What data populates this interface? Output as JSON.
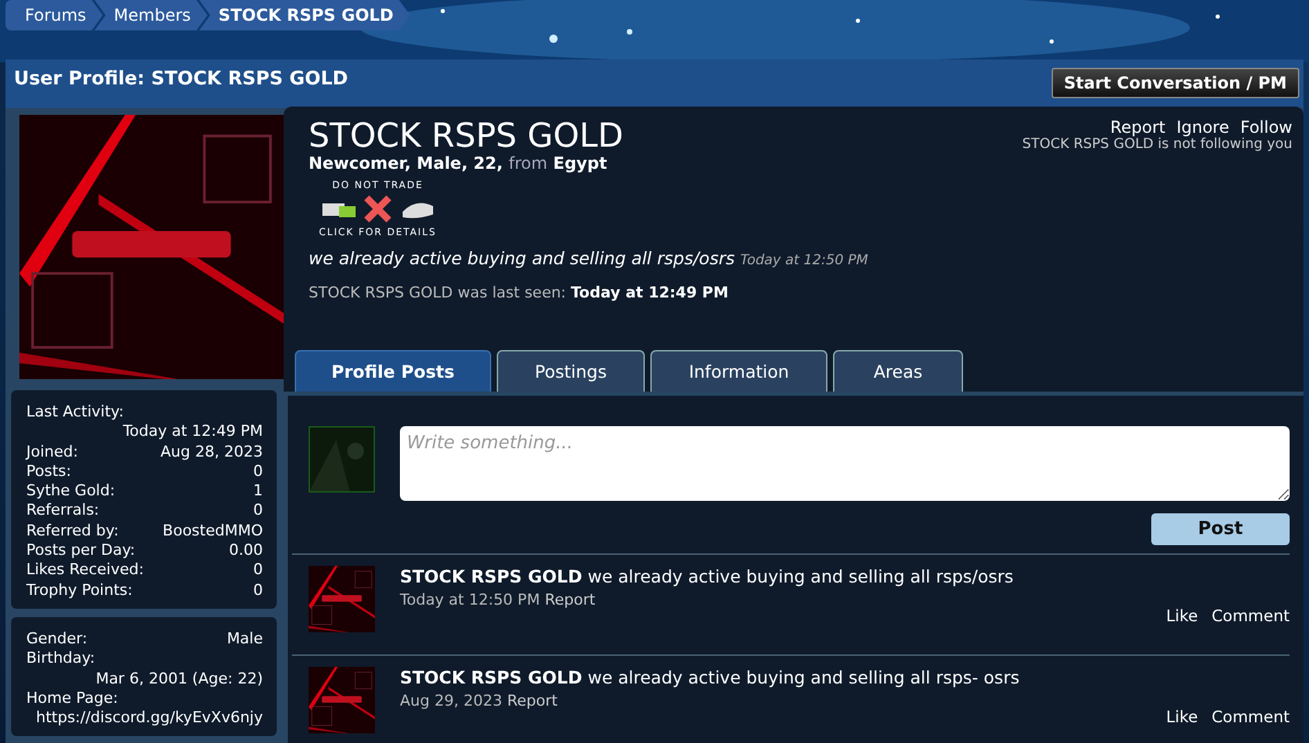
{
  "breadcrumbs": [
    {
      "label": "Forums",
      "selected": false
    },
    {
      "label": "Members",
      "selected": false
    },
    {
      "label": "STOCK RSPS GOLD",
      "selected": true
    }
  ],
  "header": {
    "title": "User Profile: STOCK RSPS GOLD",
    "button": "Start Conversation / PM"
  },
  "stats": [
    {
      "label": "Last Activity:",
      "value": "Today at 12:49 PM"
    },
    {
      "label": "Joined:",
      "value": "Aug 28, 2023"
    },
    {
      "label": "Posts:",
      "value": "0"
    },
    {
      "label": "Sythe Gold:",
      "value": "1"
    },
    {
      "label": "Referrals:",
      "value": "0"
    },
    {
      "label": "Referred by:",
      "value": "BoostedMMO"
    },
    {
      "label": "Posts per Day:",
      "value": "0.00"
    },
    {
      "label": "Likes Received:",
      "value": "0"
    },
    {
      "label": "Trophy Points:",
      "value": "0"
    }
  ],
  "about": [
    {
      "label": "Gender:",
      "value": "Male"
    },
    {
      "label": "Birthday:",
      "value": "Mar 6, 2001 (Age: 22)"
    },
    {
      "label": "Home Page:",
      "value": "https://discord.gg/kyEvXv6njy"
    }
  ],
  "profile": {
    "name": "STOCK RSPS GOLD",
    "title": "Newcomer, Male, 22,",
    "from_word": "from",
    "location": "Egypt",
    "badge_top": "DO NOT TRADE",
    "badge_bottom": "CLICK FOR DETAILS",
    "status": "we already active buying and selling all rsps/osrs",
    "status_time": "Today at 12:50 PM",
    "last_seen_label": "STOCK RSPS GOLD was last seen:",
    "last_seen": "Today at 12:49 PM",
    "actions": [
      "Report",
      "Ignore",
      "Follow"
    ],
    "follow_note": "STOCK RSPS GOLD is not following you"
  },
  "tabs": [
    {
      "label": "Profile Posts",
      "selected": true
    },
    {
      "label": "Postings",
      "selected": false
    },
    {
      "label": "Information",
      "selected": false
    },
    {
      "label": "Areas",
      "selected": false
    }
  ],
  "composer": {
    "placeholder": "Write something...",
    "button": "Post"
  },
  "posts": [
    {
      "author": "STOCK RSPS GOLD",
      "text": "we already active buying and selling all rsps/osrs",
      "time": "Today at 12:50 PM",
      "report": "Report",
      "like": "Like",
      "comment": "Comment"
    },
    {
      "author": "STOCK RSPS GOLD",
      "text": "we already active buying and selling all rsps- osrs",
      "time": "Aug 29, 2023",
      "report": "Report",
      "like": "Like",
      "comment": "Comment"
    }
  ]
}
